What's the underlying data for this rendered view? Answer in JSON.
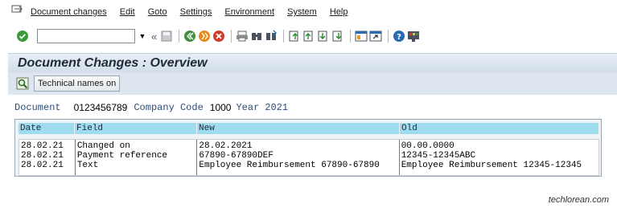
{
  "menubar": {
    "items": [
      "Document changes",
      "Edit",
      "Goto",
      "Settings",
      "Environment",
      "System",
      "Help"
    ]
  },
  "toolbar": {
    "command_field_value": "",
    "back_glyph": "«"
  },
  "title": "Document Changes : Overview",
  "app_toolbar": {
    "technical_names_label": "Technical names on"
  },
  "header": {
    "document_label": "Document",
    "document_value": "0123456789",
    "company_code_label": "Company Code",
    "company_code_value": "1000",
    "year_label": "Year",
    "year_value": "2021"
  },
  "table": {
    "columns": [
      "Date",
      "Field",
      "New",
      "Old"
    ],
    "rows": [
      {
        "date": "28.02.21",
        "field": "Changed on",
        "new": "28.02.2021",
        "old": "00.00.0000"
      },
      {
        "date": "28.02.21",
        "field": "Payment reference",
        "new": "67890-67890DEF",
        "old": "12345-12345ABC"
      },
      {
        "date": "28.02.21",
        "field": "Text",
        "new": "Employee Reimbursement 67890-67890",
        "old": "Employee Reimbursement 12345-12345"
      }
    ]
  },
  "watermark": "techlorean.com",
  "colors": {
    "title_bg": "#d2dde9",
    "table_header": "#9fdcef",
    "label": "#2a4d7a"
  }
}
